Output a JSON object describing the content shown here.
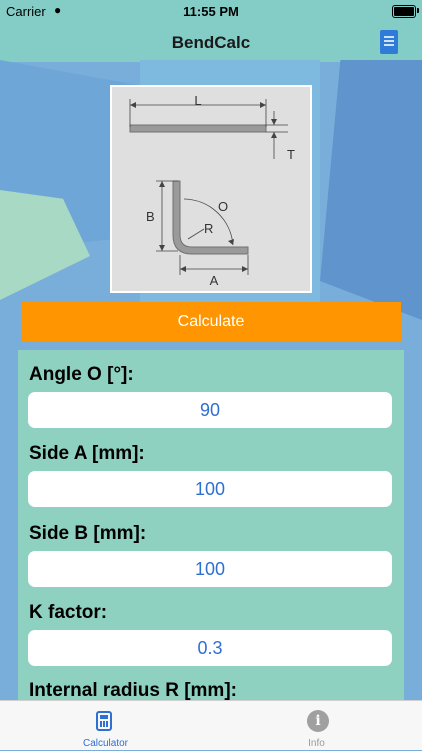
{
  "status_bar": {
    "carrier": "Carrier",
    "time": "11:55 PM"
  },
  "nav": {
    "title": "BendCalc",
    "book_icon": "book-icon"
  },
  "diagram": {
    "label_L": "L",
    "label_T": "T",
    "label_B": "B",
    "label_O": "O",
    "label_R": "R",
    "label_A": "A"
  },
  "calculate_label": "Calculate",
  "fields": [
    {
      "label": "Angle O [°]:",
      "value": "90"
    },
    {
      "label": "Side A [mm]:",
      "value": "100"
    },
    {
      "label": "Side B [mm]:",
      "value": "100"
    },
    {
      "label": "K factor:",
      "value": "0.3"
    },
    {
      "label": "Internal radius R [mm]:",
      "value": ""
    }
  ],
  "tabs": [
    {
      "label": "Calculator",
      "icon": "calculator-icon",
      "active": true
    },
    {
      "label": "Info",
      "icon": "info-icon",
      "active": false
    }
  ],
  "colors": {
    "accent": "#2f6fd1",
    "button": "#ff9500",
    "panel": "#8ed1c0"
  }
}
